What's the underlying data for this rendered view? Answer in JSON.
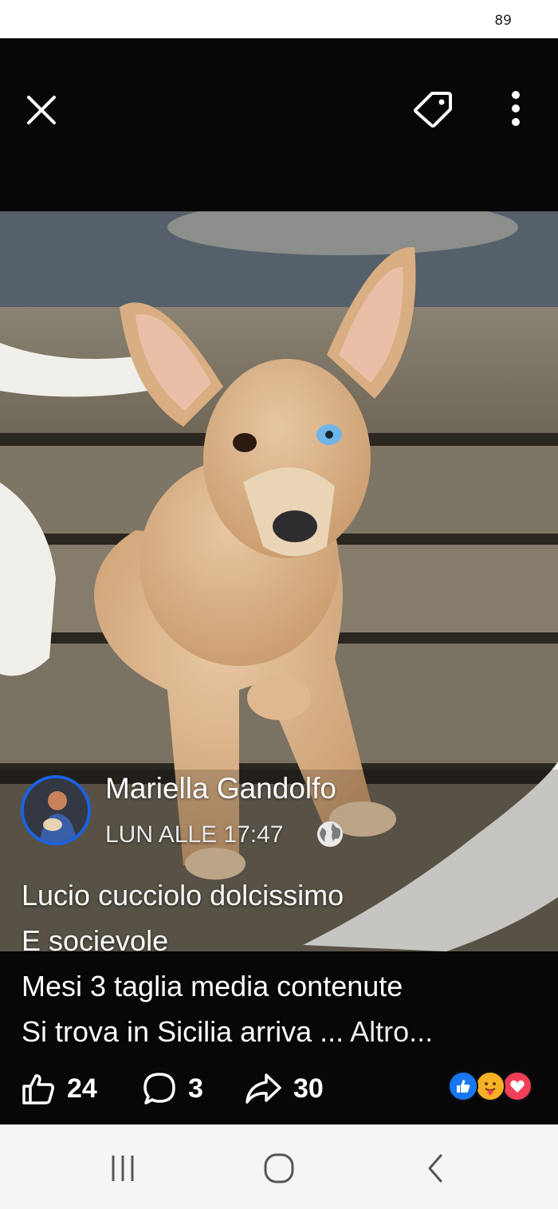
{
  "status_bar": {
    "battery": "89"
  },
  "top_bar": {
    "close_icon": "close-icon",
    "tag_icon": "tag-icon",
    "more_icon": "more-vertical-icon"
  },
  "post": {
    "author": "Mariella Gandolfo",
    "time": "LUN ALLE 17:47",
    "privacy_icon": "globe-icon",
    "caption_lines": [
      "Lucio cucciolo dolcissimo",
      "E socievole",
      "Mesi 3 taglia media contenute",
      "Si trova in Sicilia arriva ... "
    ],
    "more_label": "Altro..."
  },
  "actions": {
    "likes": "24",
    "comments": "3",
    "shares": "30"
  },
  "reactions": [
    "like",
    "care",
    "love"
  ],
  "colors": {
    "avatar_ring": "#1b62e3",
    "like_blue": "#1877f2",
    "love_red": "#f33e58",
    "care_yellow": "#f7b125"
  },
  "nav": [
    "recent-apps",
    "home",
    "back"
  ]
}
